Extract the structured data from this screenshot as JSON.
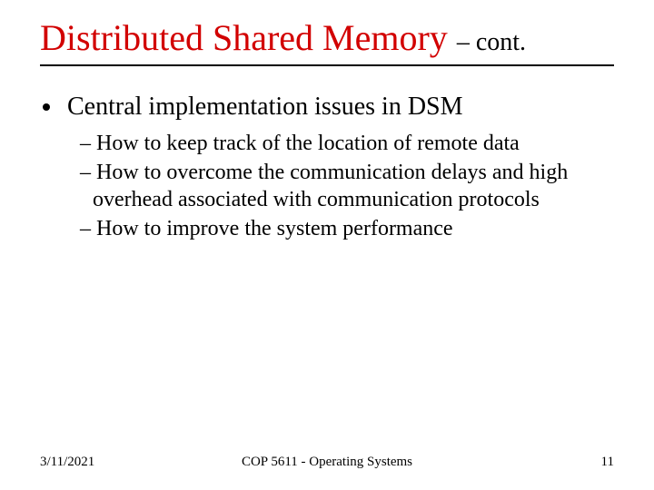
{
  "title": {
    "main": "Distributed Shared Memory",
    "suffix": "– cont."
  },
  "content": {
    "bullet1": "Central implementation issues in DSM",
    "sub": [
      "– How to keep track of the location of remote data",
      "– How to overcome the communication delays and high overhead associated with communication protocols",
      "– How to improve the system performance"
    ]
  },
  "footer": {
    "date": "3/11/2021",
    "course": "COP 5611 - Operating Systems",
    "page": "11"
  }
}
